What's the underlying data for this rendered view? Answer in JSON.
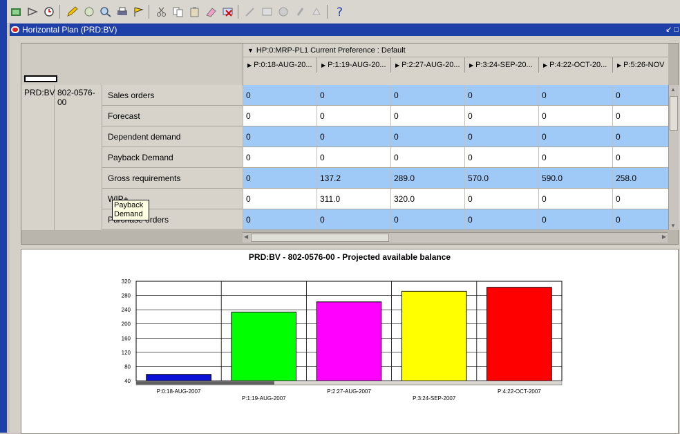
{
  "window": {
    "title": "Horizontal Plan (PRD:BV)"
  },
  "toolbar": {
    "icons": [
      "new-icon",
      "forward-icon",
      "clock-icon",
      "edit-icon",
      "attach-icon",
      "find-icon",
      "print-icon",
      "flag-icon",
      "cut-icon",
      "copy-icon",
      "paste-icon",
      "clear-icon",
      "delete-icon",
      "edit-field-icon",
      "zoom-icon",
      "translate-icon",
      "attachments-icon",
      "folder-tools-icon",
      "help-icon"
    ]
  },
  "grid": {
    "header_line": "HP:0:MRP-PL1  Current Preference : Default",
    "columns": [
      "P:0:18-AUG-20...",
      "P:1:19-AUG-20...",
      "P:2:27-AUG-20...",
      "P:3:24-SEP-20...",
      "P:4:22-OCT-20...",
      "P:5:26-NOV"
    ],
    "org": "PRD:BV",
    "item": "802-0576-00",
    "rows": [
      {
        "label": "Sales orders",
        "values": [
          "0",
          "0",
          "0",
          "0",
          "0",
          "0"
        ],
        "style": "blue"
      },
      {
        "label": "Forecast",
        "values": [
          "0",
          "0",
          "0",
          "0",
          "0",
          "0"
        ],
        "style": "white"
      },
      {
        "label": "Dependent demand",
        "values": [
          "0",
          "0",
          "0",
          "0",
          "0",
          "0"
        ],
        "style": "blue"
      },
      {
        "label": "Payback Demand",
        "values": [
          "0",
          "0",
          "0",
          "0",
          "0",
          "0"
        ],
        "style": "white"
      },
      {
        "label": "Gross requirements",
        "values": [
          "0",
          "137.2",
          "289.0",
          "570.0",
          "590.0",
          "258.0"
        ],
        "style": "blue"
      },
      {
        "label": "WIP+",
        "values": [
          "0",
          "311.0",
          "320.0",
          "0",
          "0",
          "0"
        ],
        "style": "white"
      },
      {
        "label": "Purchase orders",
        "values": [
          "0",
          "0",
          "0",
          "0",
          "0",
          "0"
        ],
        "style": "blue"
      }
    ],
    "tooltip": "Payback Demand"
  },
  "chart_data": {
    "type": "bar",
    "title": "PRD:BV - 802-0576-00 - Projected available balance",
    "categories": [
      "P:0:18-AUG-2007",
      "P:1:19-AUG-2007",
      "P:2:27-AUG-2007",
      "P:3:24-SEP-2007",
      "P:4:22-OCT-2007"
    ],
    "values": [
      58,
      233,
      262,
      292,
      303
    ],
    "colors": [
      "#0a10d8",
      "#00ff00",
      "#ff00ff",
      "#ffff00",
      "#ff0000"
    ],
    "yticks": [
      40,
      80,
      120,
      160,
      200,
      240,
      280,
      320
    ],
    "ylim": [
      40,
      320
    ],
    "grid": true
  }
}
